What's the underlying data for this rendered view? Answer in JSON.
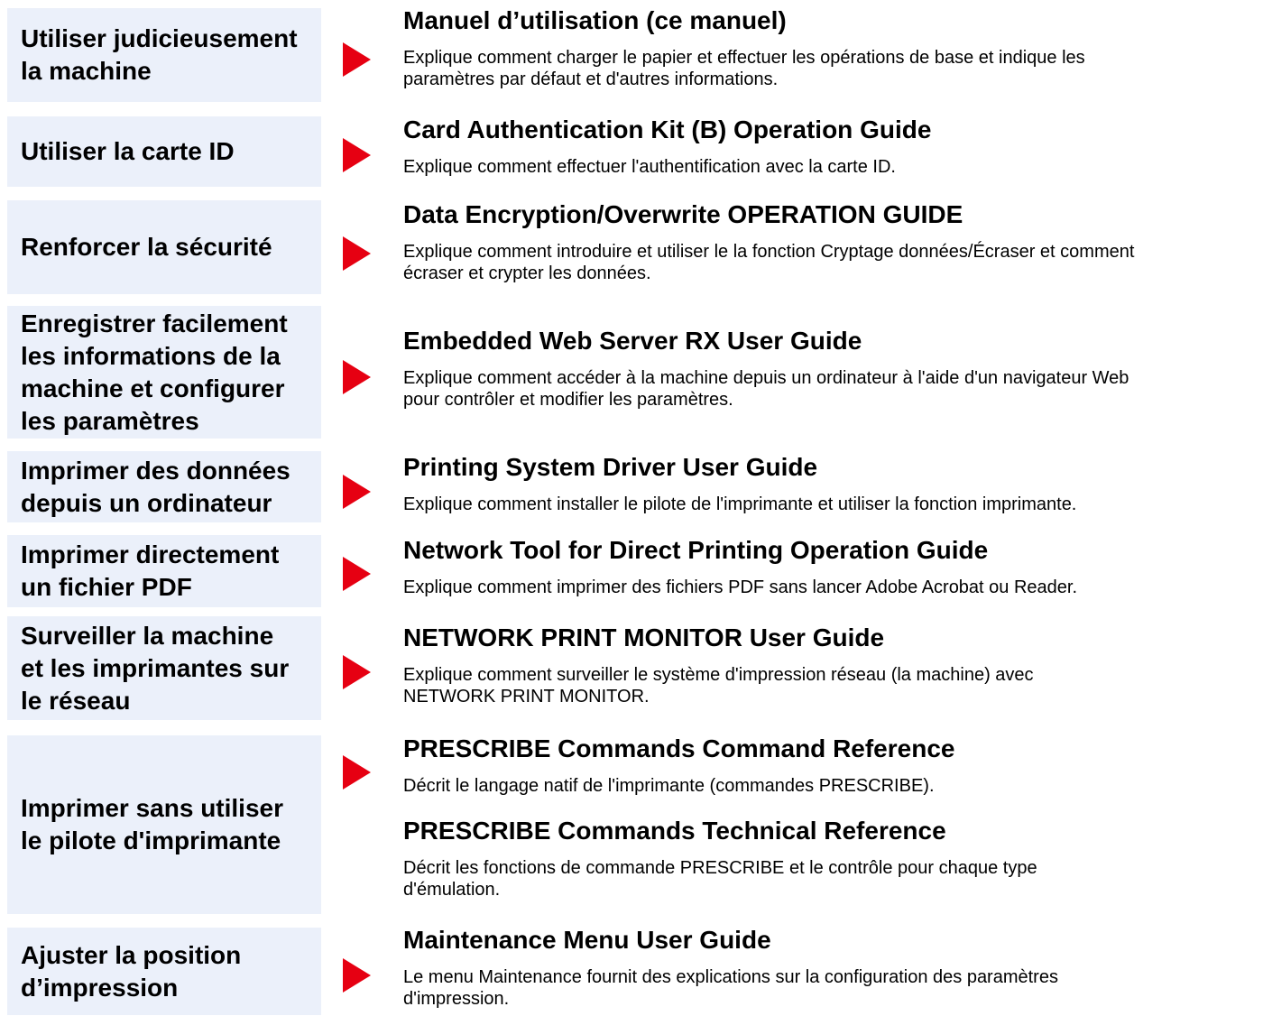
{
  "rows": [
    {
      "task": "Utiliser judicieusement\nla machine",
      "guides": [
        {
          "title": "Manuel d’utilisation (ce manuel)",
          "description": "Explique comment charger le papier et effectuer les opérations de base et indique les\nparamètres par défaut et d'autres informations."
        }
      ]
    },
    {
      "task": "Utiliser la carte ID",
      "guides": [
        {
          "title": "Card Authentication Kit (B) Operation Guide",
          "description": "Explique comment effectuer l'authentification avec la carte ID."
        }
      ]
    },
    {
      "task": "Renforcer la sécurité",
      "guides": [
        {
          "title": "Data Encryption/Overwrite OPERATION GUIDE",
          "description": "Explique comment introduire et utiliser le la fonction Cryptage données/Écraser et comment\nécraser et crypter les données."
        }
      ]
    },
    {
      "task": "Enregistrer facilement\nles informations de la\nmachine et configurer\nles paramètres",
      "guides": [
        {
          "title": "Embedded Web Server RX User Guide",
          "description": "Explique comment accéder à la machine depuis un ordinateur à l'aide d'un navigateur Web\npour contrôler et modifier les paramètres."
        }
      ]
    },
    {
      "task": "Imprimer des données\ndepuis un ordinateur",
      "guides": [
        {
          "title": "Printing System Driver User Guide",
          "description": "Explique comment installer le pilote de l'imprimante et utiliser la fonction imprimante."
        }
      ]
    },
    {
      "task": "Imprimer directement\nun fichier PDF",
      "guides": [
        {
          "title": "Network Tool for Direct Printing Operation Guide",
          "description": "Explique comment imprimer des fichiers PDF sans lancer Adobe Acrobat ou Reader."
        }
      ]
    },
    {
      "task": "Surveiller la machine\net les imprimantes sur\nle réseau",
      "guides": [
        {
          "title": "NETWORK PRINT MONITOR User Guide",
          "description": "Explique comment surveiller le système d'impression réseau (la machine) avec\nNETWORK PRINT MONITOR."
        }
      ]
    },
    {
      "task": "Imprimer sans utiliser\nle pilote d'imprimante",
      "guides": [
        {
          "title": "PRESCRIBE Commands Command Reference",
          "description": "Décrit le langage natif de l'imprimante (commandes PRESCRIBE)."
        },
        {
          "title": "PRESCRIBE Commands Technical Reference",
          "description": "Décrit les fonctions de commande PRESCRIBE et le contrôle pour chaque type\nd'émulation."
        }
      ]
    },
    {
      "task": "Ajuster la position\nd’impression",
      "guides": [
        {
          "title": "Maintenance Menu User Guide",
          "description": "Le menu Maintenance fournit des explications sur la configuration des paramètres\nd'impression."
        }
      ]
    }
  ],
  "colors": {
    "task_box": "#ebf0fa",
    "arrow": "#e60012",
    "text": "#000000"
  }
}
